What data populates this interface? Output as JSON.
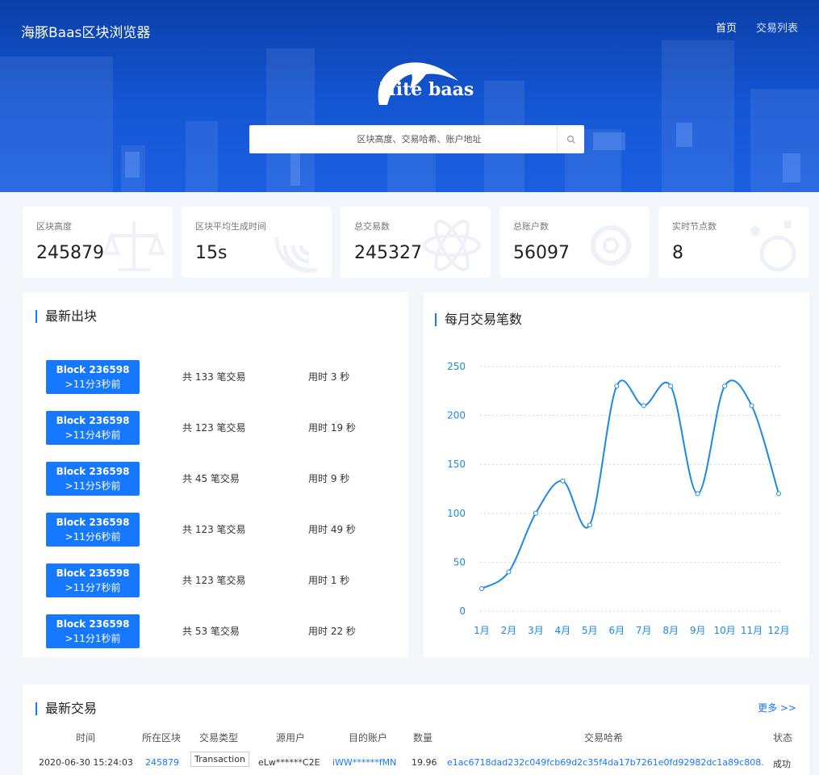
{
  "header": {
    "site_title": "海豚Baas区块浏览器",
    "nav": [
      {
        "label": "首页"
      },
      {
        "label": "交易列表"
      }
    ],
    "logo_text": "Hite baas",
    "search": {
      "placeholder": "区块高度、交易哈希、账户地址",
      "icon": "search-icon"
    }
  },
  "stats": [
    {
      "label": "区块高度",
      "value": "245879",
      "icon": "scale-icon"
    },
    {
      "label": "区块平均生成时间",
      "value": "15s",
      "icon": "signal-icon"
    },
    {
      "label": "总交易数",
      "value": "245327",
      "icon": "atom-icon"
    },
    {
      "label": "总账户数",
      "value": "56097",
      "icon": "gear-icon"
    },
    {
      "label": "实时节点数",
      "value": "8",
      "icon": "nodes-icon"
    }
  ],
  "latest_blocks": {
    "title": "最新出块",
    "items": [
      {
        "block": "Block 236598",
        "age": ">11分3秒前",
        "tx": "共 133 笔交易",
        "time": "用时 3 秒"
      },
      {
        "block": "Block 236598",
        "age": ">11分4秒前",
        "tx": "共 123 笔交易",
        "time": "用时 19 秒"
      },
      {
        "block": "Block 236598",
        "age": ">11分5秒前",
        "tx": "共 45 笔交易",
        "time": "用时 9 秒"
      },
      {
        "block": "Block 236598",
        "age": ">11分6秒前",
        "tx": "共 123 笔交易",
        "time": "用时 49 秒"
      },
      {
        "block": "Block 236598",
        "age": ">11分7秒前",
        "tx": "共 123 笔交易",
        "time": "用时 1 秒"
      },
      {
        "block": "Block 236598",
        "age": ">11分1秒前",
        "tx": "共 53 笔交易",
        "time": "用时 22 秒"
      }
    ]
  },
  "monthly_chart": {
    "title": "每月交易笔数"
  },
  "chart_data": {
    "type": "line",
    "title": "每月交易笔数",
    "xlabel": "",
    "ylabel": "",
    "categories": [
      "1月",
      "2月",
      "3月",
      "4月",
      "5月",
      "6月",
      "7月",
      "8月",
      "9月",
      "10月",
      "11月",
      "12月"
    ],
    "values": [
      23,
      40,
      100,
      133,
      88,
      230,
      210,
      230,
      120,
      230,
      210,
      120
    ],
    "ylim": [
      0,
      250
    ],
    "yticks": [
      0,
      50,
      100,
      150,
      200,
      250
    ],
    "grid": true,
    "color": "#1e88e5"
  },
  "latest_transactions": {
    "title": "最新交易",
    "more": "更多 >>",
    "columns": [
      "时间",
      "所在区块",
      "交易类型",
      "源用户",
      "目的账户",
      "数量",
      "交易哈希",
      "状态"
    ],
    "rows": [
      {
        "time": "2020-06-30 15:24:03",
        "block": "245879",
        "type": "Transaction",
        "from": "eLw******C2E",
        "to": "iWW******fMN",
        "amount": "19.96",
        "hash": "e1ac6718dad232c049fcb69d2c35f4da17b7261e0fd92982dc1a89c808...",
        "status": "成功"
      }
    ]
  },
  "colors": {
    "primary": "#1677ff",
    "hero": "#1556d4",
    "line": "#1e88e5"
  }
}
